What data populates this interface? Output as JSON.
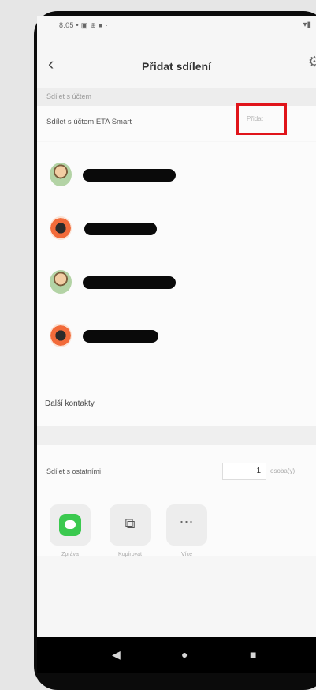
{
  "status": {
    "time": "8:05",
    "icons": "• ▣ ⊕ ■ ·",
    "right": "▾▮"
  },
  "header": {
    "title": "Přidat sdílení",
    "back": "‹",
    "settings": "⚙"
  },
  "section_label": "Sdílet s účtem",
  "share_account": {
    "label": "Sdílet s účtem ETA Smart",
    "add_label": "Přidat"
  },
  "contacts": [
    {
      "avatar": "person"
    },
    {
      "avatar": "robot"
    },
    {
      "avatar": "person"
    },
    {
      "avatar": "robot"
    }
  ],
  "more_contacts": "Další kontakty",
  "share_others": {
    "label": "Sdílet s ostatními",
    "count": "1",
    "unit": "osoba(y)"
  },
  "share_buttons": [
    {
      "label": "Zpráva",
      "icon": "message-icon"
    },
    {
      "label": "Kopírovat",
      "icon": "copy-icon"
    },
    {
      "label": "Více",
      "icon": "more-icon"
    }
  ],
  "bottom_nav": {
    "back": "◀",
    "home": "●",
    "recents": "■"
  },
  "colors": {
    "highlight": "#e0141a",
    "message": "#3bc94f"
  }
}
